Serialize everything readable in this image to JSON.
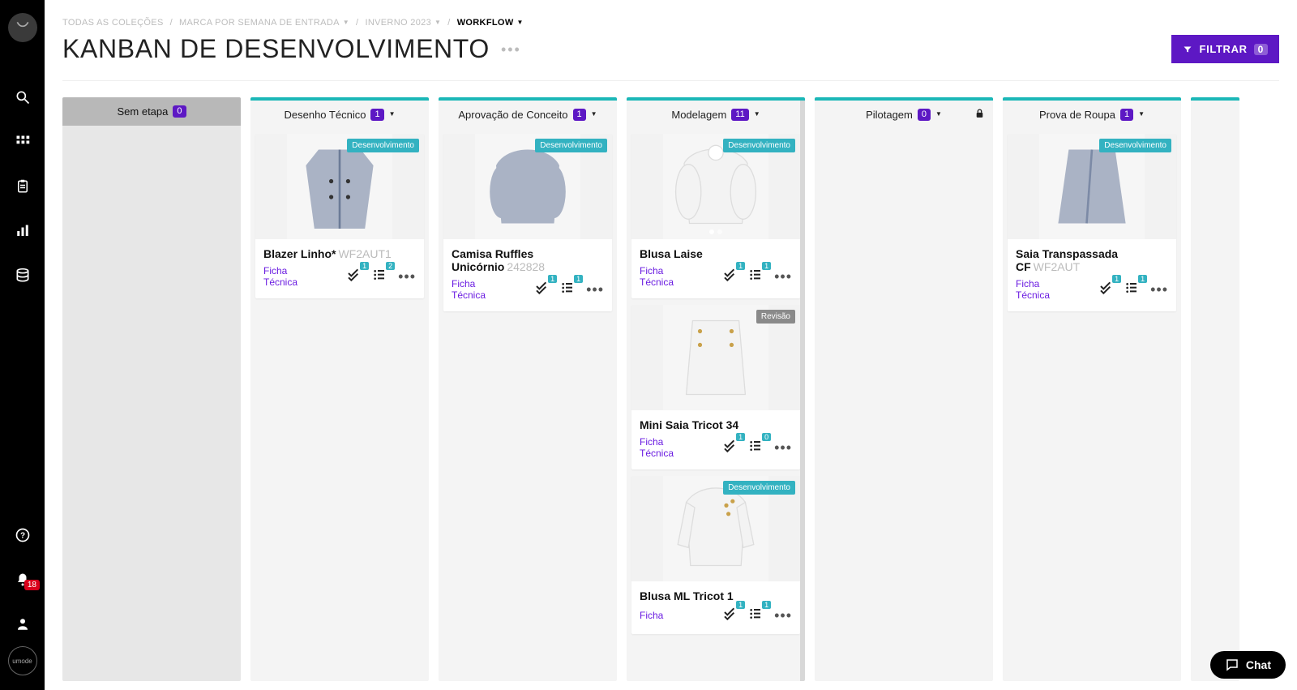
{
  "sidebar": {
    "notifications_count": "18",
    "bottom_logo_label": "umode"
  },
  "breadcrumbs": {
    "items": [
      {
        "label": "TODAS AS COLEÇÕES",
        "has_caret": false
      },
      {
        "label": "MARCA POR SEMANA DE ENTRADA",
        "has_caret": true
      },
      {
        "label": "INVERNO 2023",
        "has_caret": true
      }
    ],
    "current": "WORKFLOW"
  },
  "page": {
    "title": "KANBAN DE DESENVOLVIMENTO"
  },
  "filter": {
    "label": "FILTRAR",
    "count": "0"
  },
  "chat": {
    "label": "Chat"
  },
  "columns": [
    {
      "id": "sem-etapa",
      "title": "Sem etapa",
      "count": "0",
      "special": "sem-etapa",
      "has_caret": false,
      "locked": false,
      "cards": []
    },
    {
      "id": "desenho-tecnico",
      "title": "Desenho Técnico",
      "count": "1",
      "has_caret": true,
      "locked": false,
      "cards": [
        {
          "title": "Blazer Linho*",
          "code": "WF2AUT1",
          "status": "Desenvolvimento",
          "status_class": "status-dev",
          "ficha": "Ficha Técnica",
          "badge1": "1",
          "badge2": "2",
          "garment": "blazer",
          "slider": false
        }
      ]
    },
    {
      "id": "aprovacao-conceito",
      "title": "Aprovação de Conceito",
      "count": "1",
      "has_caret": true,
      "locked": false,
      "cards": [
        {
          "title": "Camisa Ruffles Unicórnio",
          "code": "242828",
          "status": "Desenvolvimento",
          "status_class": "status-dev",
          "ficha": "Ficha Técnica",
          "badge1": "1",
          "badge2": "1",
          "garment": "blouse-pattern",
          "slider": false
        }
      ]
    },
    {
      "id": "modelagem",
      "title": "Modelagem",
      "count": "11",
      "has_caret": true,
      "locked": false,
      "cards": [
        {
          "title": "Blusa Laise",
          "code": "",
          "status": "Desenvolvimento",
          "status_class": "status-dev",
          "ficha": "Ficha Técnica",
          "badge1": "1",
          "badge2": "1",
          "garment": "blouse-white",
          "slider": true
        },
        {
          "title": "Mini Saia Tricot 34",
          "code": "",
          "status": "Revisão",
          "status_class": "status-rev",
          "ficha": "Ficha Técnica",
          "badge1": "1",
          "badge2": "0",
          "garment": "skirt-buttons",
          "slider": false
        },
        {
          "title": "Blusa ML Tricot 1",
          "code": "",
          "status": "Desenvolvimento",
          "status_class": "status-dev",
          "ficha": "Ficha",
          "badge1": "1",
          "badge2": "1",
          "garment": "jumper-white",
          "slider": false,
          "truncated": true
        }
      ]
    },
    {
      "id": "pilotagem",
      "title": "Pilotagem",
      "count": "0",
      "has_caret": true,
      "locked": true,
      "cards": []
    },
    {
      "id": "prova-roupa",
      "title": "Prova de Roupa",
      "count": "1",
      "has_caret": true,
      "locked": false,
      "cards": [
        {
          "title": "Saia Transpassada CF",
          "code": "WF2AUT",
          "status": "Desenvolvimento",
          "status_class": "status-dev",
          "ficha": "Ficha Técnica",
          "badge1": "1",
          "badge2": "1",
          "garment": "skirt-pattern",
          "slider": false
        }
      ]
    },
    {
      "id": "next-partial",
      "title": "",
      "count": "",
      "has_caret": false,
      "locked": false,
      "partial": true,
      "cards": []
    }
  ]
}
